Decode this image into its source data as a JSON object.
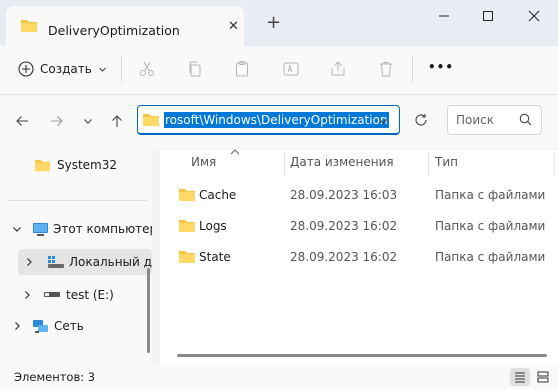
{
  "window": {
    "tab_title": "DeliveryOptimization",
    "tab_close_glyph": "✕",
    "new_tab_glyph": "+"
  },
  "toolbar": {
    "create_label": "Создать",
    "more_glyph": "•••"
  },
  "address": {
    "path": "rosoft\\Windows\\DeliveryOptimization",
    "search_placeholder": "Поиск"
  },
  "sidebar": {
    "items": [
      {
        "label": "System32",
        "icon": "folder-icon"
      },
      {
        "label": "Этот компьютер",
        "icon": "computer-icon"
      },
      {
        "label": "Локальный ди",
        "icon": "drive-icon"
      },
      {
        "label": "test (E:)",
        "icon": "usb-drive-icon"
      },
      {
        "label": "Сеть",
        "icon": "network-icon"
      }
    ]
  },
  "columns": {
    "name": "Имя",
    "date": "Дата изменения",
    "type": "Тип"
  },
  "files": [
    {
      "name": "Cache",
      "date": "28.09.2023 16:03",
      "type": "Папка с файлами"
    },
    {
      "name": "Logs",
      "date": "28.09.2023 16:02",
      "type": "Папка с файлами"
    },
    {
      "name": "State",
      "date": "28.09.2023 16:02",
      "type": "Папка с файлами"
    }
  ],
  "status": {
    "item_count": "Элементов: 3"
  },
  "colors": {
    "accent": "#0067c0",
    "selection": "#0078d7",
    "folder": "#f8c543"
  }
}
